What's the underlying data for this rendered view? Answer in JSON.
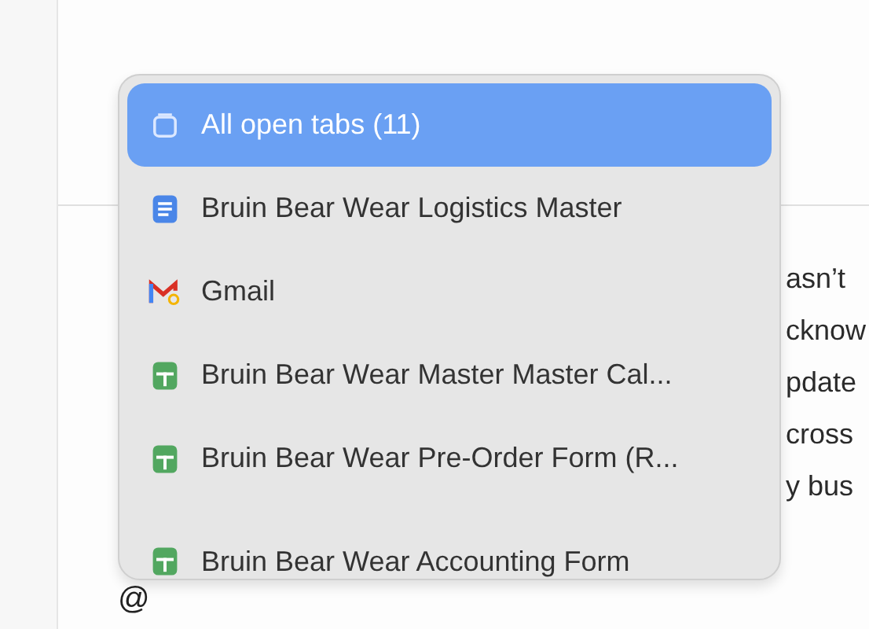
{
  "menu": {
    "items": [
      {
        "kind": "tabs",
        "label": "All open tabs (11)",
        "selected": true
      },
      {
        "kind": "doc",
        "label": "Bruin Bear Wear Logistics Master",
        "selected": false
      },
      {
        "kind": "mail",
        "label": "Gmail",
        "selected": false
      },
      {
        "kind": "sheet",
        "label": "Bruin Bear Wear Master Master Cal...",
        "selected": false
      },
      {
        "kind": "sheet",
        "label": "Bruin Bear Wear Pre-Order Form (R...",
        "selected": false
      },
      {
        "kind": "sheet",
        "label": "Bruin Bear Wear Accounting Form",
        "selected": false
      }
    ]
  },
  "background_text": [
    "asn’t",
    "cknow",
    "pdate",
    "cross",
    "y bus"
  ],
  "editor": {
    "value": "@"
  }
}
